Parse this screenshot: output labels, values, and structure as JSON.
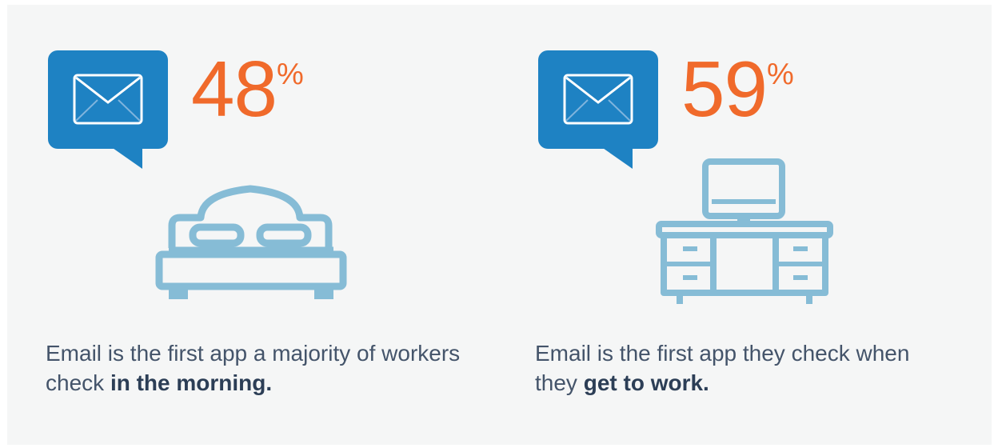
{
  "stats": [
    {
      "percent_value": "48",
      "percent_symbol": "%",
      "icon": "envelope-bubble-icon",
      "illustration": "bed-icon",
      "caption_text": "Email is the first app a majority of workers check",
      "caption_emphasis": "in the morning."
    },
    {
      "percent_value": "59",
      "percent_symbol": "%",
      "icon": "envelope-bubble-icon",
      "illustration": "desk-computer-icon",
      "caption_text": "Email is the first app they check when they",
      "caption_emphasis": "get to work."
    }
  ],
  "colors": {
    "accent_orange": "#f06a2b",
    "bubble_blue": "#1e82c3",
    "illustration_blue": "#86bcd6",
    "text_gray": "#44546a",
    "background": "#f5f6f6"
  }
}
